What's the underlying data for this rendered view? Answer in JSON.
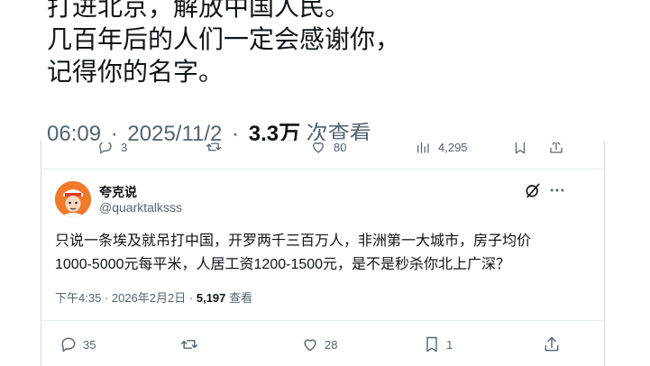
{
  "top_tweet": {
    "lines": [
      "打进北京，解放中国人民。",
      "几百年后的人们一定会感谢你，",
      "记得你的名字。"
    ],
    "time": "06:09",
    "date": "2025/11/2",
    "dot": "·",
    "views_count": "3.3万",
    "views_label": "次查看",
    "actions": {
      "replies": "3",
      "likes": "80",
      "views": "4,295"
    }
  },
  "reply": {
    "display_name": "夸克说",
    "handle": "@quarktalksss",
    "text_lines": [
      "只说一条埃及就吊打中国，开罗两千三百万人，非洲第一大城市，房子均价",
      "1000-5000元每平米，人居工资1200-1500元，是不是秒杀你北上广深？"
    ],
    "time": "下午4:35",
    "date": "2026年2月2日",
    "views_count": "5,197",
    "views_label": "查看",
    "actions": {
      "replies": "35",
      "likes": "28",
      "bookmarks": "1"
    }
  },
  "colors": {
    "text": "#0f1419",
    "muted": "#536471",
    "border": "#cfd9de",
    "avatar": "#f07a2a"
  }
}
